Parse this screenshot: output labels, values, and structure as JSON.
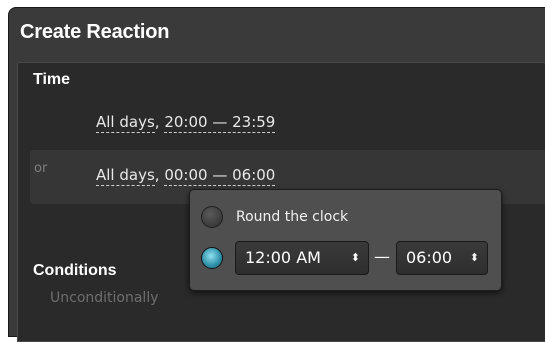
{
  "dialog": {
    "title": "Create Reaction"
  },
  "time_section": {
    "heading": "Time",
    "rows": [
      {
        "days": "All days",
        "comma": ",",
        "range": "20:00 — 23:59"
      },
      {
        "prefix": "or",
        "days": "All days",
        "comma": ",",
        "range": "00:00 — 06:00"
      }
    ]
  },
  "conditions_section": {
    "heading": "Conditions",
    "value": "Unconditionally"
  },
  "time_popover": {
    "round_the_clock_label": "Round the clock",
    "round_the_clock_selected": false,
    "custom_range_selected": true,
    "start_time": "12:00 AM",
    "separator": "—",
    "end_time": "06:00",
    "spin_icon": "⬍"
  },
  "colors": {
    "dialog_bg": "#3a3a3a",
    "panel_bg": "#2a2a2a",
    "popover_bg": "#4f4f4f",
    "radio_accent": "#2d8fa7"
  }
}
